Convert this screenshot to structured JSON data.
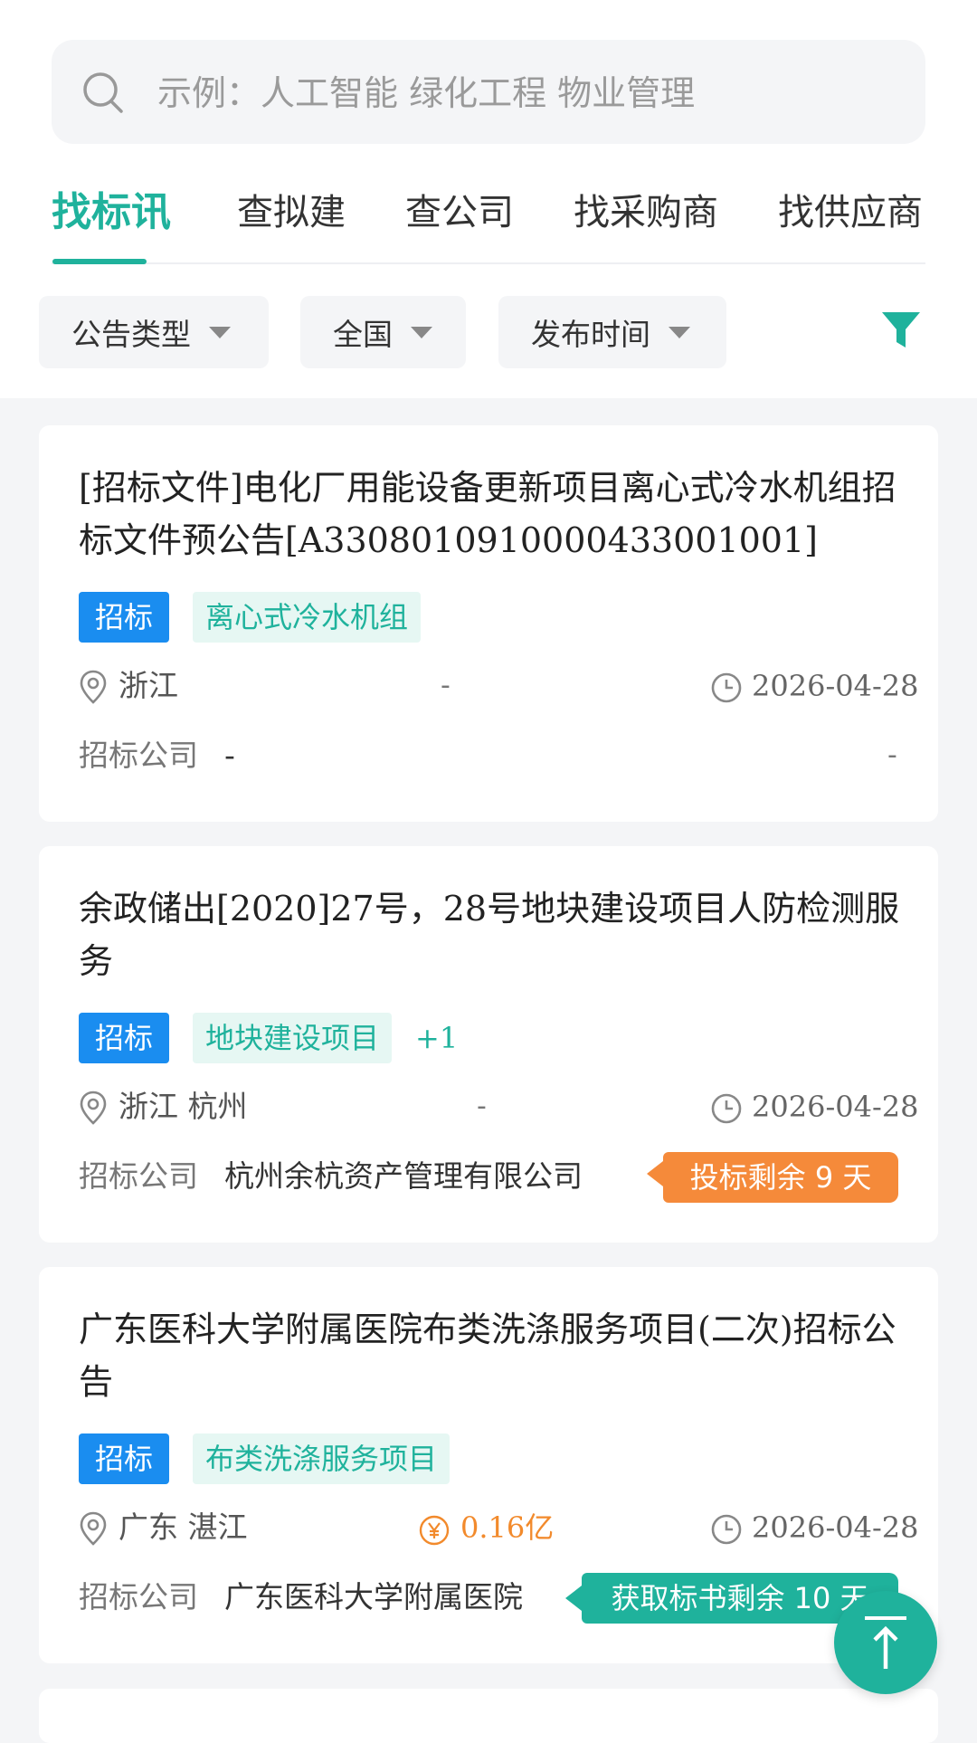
{
  "search": {
    "placeholder": "示例：人工智能 绿化工程 物业管理",
    "icon": "search-icon"
  },
  "tabs": [
    {
      "label": "找标讯",
      "active": true
    },
    {
      "label": "查拟建",
      "active": false
    },
    {
      "label": "查公司",
      "active": false
    },
    {
      "label": "找采购商",
      "active": false
    },
    {
      "label": "找供应商",
      "active": false
    }
  ],
  "filters": [
    {
      "label": "公告类型"
    },
    {
      "label": "全国"
    },
    {
      "label": "发布时间"
    }
  ],
  "colors": {
    "accent": "#1fb29c",
    "type_tag": "#1a8df0",
    "countdown_orange": "#f58a3a",
    "budget": "#f28a2c"
  },
  "company_label": "招标公司",
  "cards": [
    {
      "title": "[招标文件]电化厂用能设备更新项目离心式冷水机组招标文件预公告[A3308010910000433001001]",
      "type_tag": "招标",
      "keyword_tag": "离心式冷水机组",
      "location": "浙江",
      "budget": "-",
      "date": "2026-04-28",
      "company": "-",
      "trailing": "-"
    },
    {
      "title": "余政储出[2020]27号，28号地块建设项目人防检测服务",
      "type_tag": "招标",
      "keyword_tag": "地块建设项目",
      "more_tags": "+1",
      "location": "浙江 杭州",
      "budget": "-",
      "date": "2026-04-28",
      "company": "杭州余杭资产管理有限公司",
      "countdown": "投标剩余 9 天"
    },
    {
      "title": "广东医科大学附属医院布类洗涤服务项目(二次)招标公告",
      "type_tag": "招标",
      "keyword_tag": "布类洗涤服务项目",
      "location": "广东 湛江",
      "budget": "0.16亿",
      "date": "2026-04-28",
      "company": "广东医科大学附属医院",
      "countdown": "获取标书剩余 10 天"
    }
  ]
}
